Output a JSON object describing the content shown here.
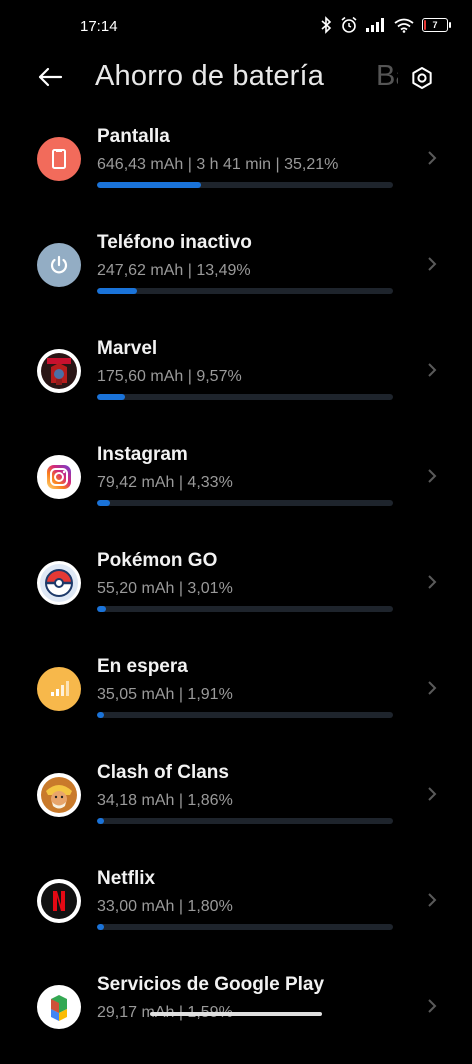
{
  "status_bar": {
    "time": "17:14",
    "battery_level": "7",
    "battery_color": "#e53935",
    "icons": [
      "bluetooth-icon",
      "alarm-icon",
      "signal-icon",
      "wifi-icon",
      "battery-icon"
    ]
  },
  "header": {
    "title": "Ahorro de batería",
    "next_tab_partial": "Ba",
    "back_icon": "arrow-left-icon",
    "settings_icon": "gear-icon"
  },
  "accent_color": "#1a73d9",
  "items": [
    {
      "name": "Pantalla",
      "detail": "646,43 mAh | 3 h 41 min  | 35,21%",
      "percent": 35.21,
      "icon": "screen-icon"
    },
    {
      "name": "Teléfono inactivo",
      "detail": "247,62 mAh | 13,49%",
      "percent": 13.49,
      "icon": "power-icon"
    },
    {
      "name": "Marvel",
      "detail": "175,60 mAh | 9,57%",
      "percent": 9.57,
      "icon": "marvel-app-icon"
    },
    {
      "name": "Instagram",
      "detail": "79,42 mAh | 4,33%",
      "percent": 4.33,
      "icon": "instagram-icon"
    },
    {
      "name": "Pokémon GO",
      "detail": "55,20 mAh | 3,01%",
      "percent": 3.01,
      "icon": "pokeball-icon"
    },
    {
      "name": "En espera",
      "detail": "35,05 mAh | 1,91%",
      "percent": 1.91,
      "icon": "signal-bars-icon"
    },
    {
      "name": "Clash of Clans",
      "detail": "34,18 mAh | 1,86%",
      "percent": 1.86,
      "icon": "clash-of-clans-icon"
    },
    {
      "name": "Netflix",
      "detail": "33,00 mAh | 1,80%",
      "percent": 1.8,
      "icon": "netflix-icon"
    },
    {
      "name": "Servicios de Google Play",
      "detail": "29,17 mAh | 1,59%",
      "percent": 1.59,
      "icon": "google-play-icon"
    }
  ]
}
